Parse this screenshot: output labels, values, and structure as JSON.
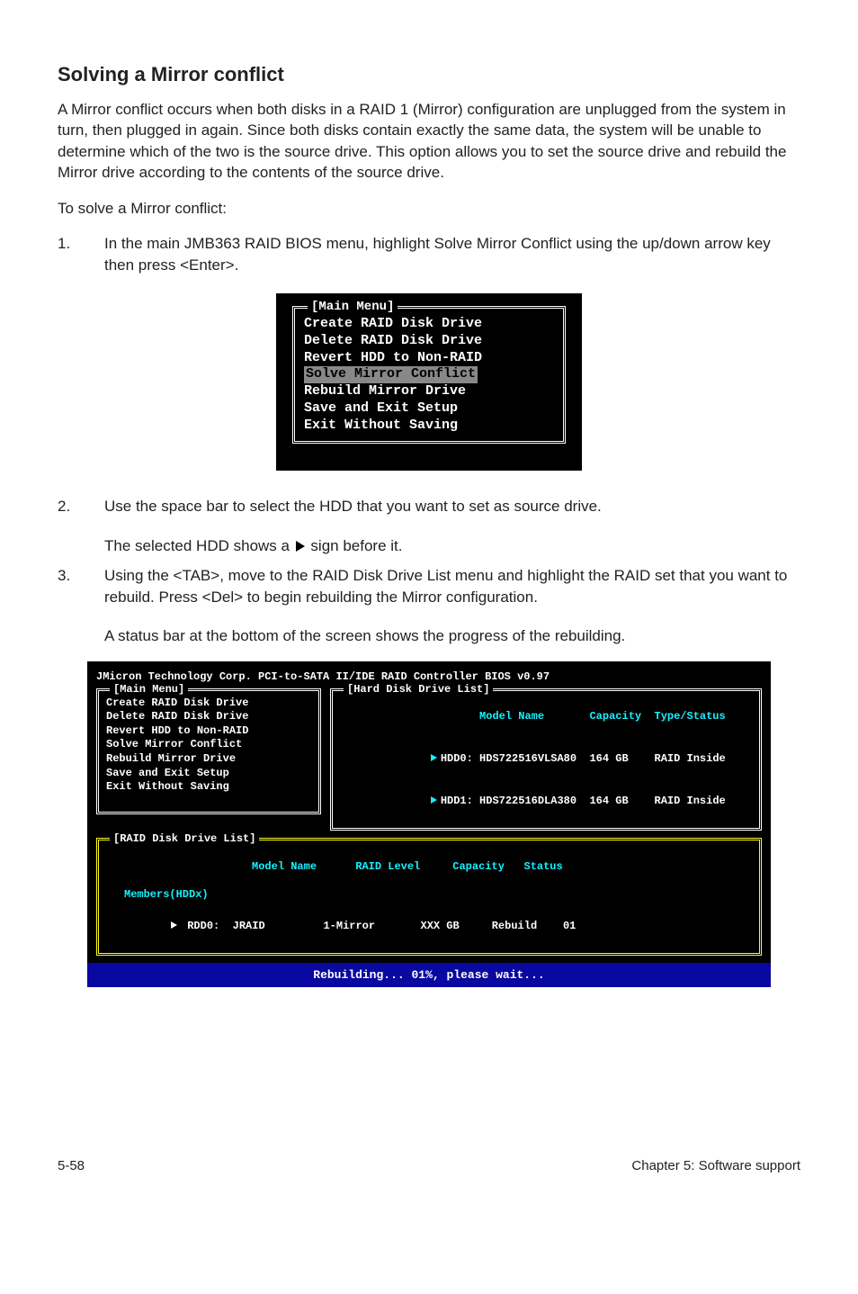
{
  "section_title": "Solving a Mirror conflict",
  "intro": "A Mirror conflict occurs when both disks in a RAID 1 (Mirror) configuration are unplugged from the system in turn, then plugged in again. Since both disks contain exactly the same data, the system will be unable to determine which of the two is the source drive. This option allows you to set the source drive and rebuild the Mirror drive according to the contents of the source drive.",
  "solve_lead": "To solve a Mirror conflict:",
  "steps": {
    "s1_num": "1.",
    "s1_txt": "In the main JMB363 RAID BIOS menu, highlight Solve Mirror Conflict using the up/down arrow key then press <Enter>.",
    "s2_num": "2.",
    "s2_txt": "Use the space bar to select the HDD that you want to set as source drive.",
    "s2_after": "The selected HDD shows a     sign before it.",
    "s3_num": "3.",
    "s3_txt": "Using the <TAB>, move to the RAID Disk Drive List menu and highlight the RAID set that you want to rebuild. Press <Del> to begin rebuilding the Mirror configuration.",
    "s3_after": "A status bar at the bottom of the screen shows the progress of the rebuilding."
  },
  "bios_small": {
    "title": "[Main Menu]",
    "items": [
      "Create RAID Disk Drive",
      "Delete RAID Disk Drive",
      "Revert HDD to Non-RAID",
      "Solve Mirror Conflict",
      "Rebuild Mirror Drive",
      "Save and Exit Setup",
      "Exit Without Saving"
    ],
    "highlight_index": 3
  },
  "bios_large": {
    "header": "JMicron Technology Corp. PCI-to-SATA II/IDE RAID Controller BIOS v0.97",
    "main_menu_title": "[Main Menu]",
    "main_menu_items": [
      "Create RAID Disk Drive",
      "Delete RAID Disk Drive",
      "Revert HDD to Non-RAID",
      "Solve Mirror Conflict",
      "Rebuild Mirror Drive",
      "Save and Exit Setup",
      "Exit Without Saving"
    ],
    "hdd_list_title": "[Hard Disk Drive List]",
    "hdd_headers": {
      "model": "Model Name",
      "capacity": "Capacity",
      "type": "Type/Status"
    },
    "hdd_rows": [
      {
        "id": "HDD0:",
        "model": "HDS722516VLSA80",
        "cap": "164 GB",
        "type": "RAID Inside"
      },
      {
        "id": "HDD1:",
        "model": "HDS722516DLA380",
        "cap": "164 GB",
        "type": "RAID Inside"
      }
    ],
    "raid_list_title": "[RAID Disk Drive List]",
    "raid_headers": {
      "model": "Model Name",
      "level": "RAID Level",
      "cap": "Capacity",
      "status": "Status"
    },
    "raid_members_label": "Members(HDDx)",
    "raid_row": {
      "id": "RDD0:",
      "name": "JRAID",
      "level": "1-Mirror",
      "cap": "XXX GB",
      "status": "Rebuild",
      "members": "01"
    },
    "status_bar": "Rebuilding... 01%, please wait..."
  },
  "footer": {
    "left": "5-58",
    "right": "Chapter 5: Software support"
  }
}
